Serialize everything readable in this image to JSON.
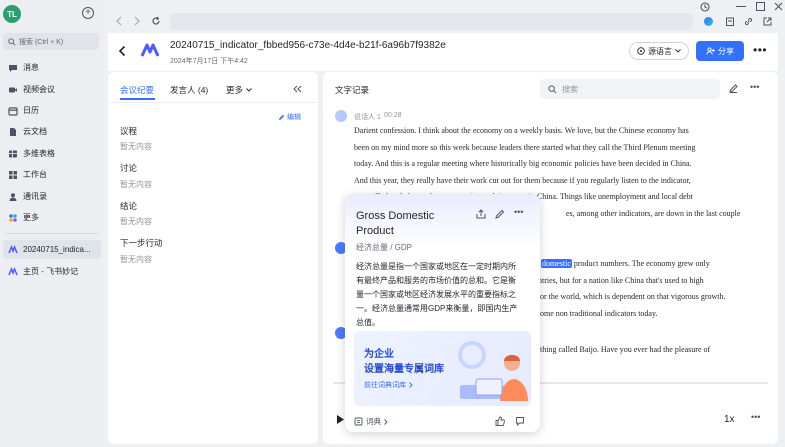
{
  "window": {
    "avatar_initials": "TL",
    "accent_color": "#3370ff"
  },
  "sidebar": {
    "search_placeholder": "搜索 (Ctrl + K)",
    "items": [
      {
        "label": "消息",
        "icon": "message-icon"
      },
      {
        "label": "视频会议",
        "icon": "video-icon"
      },
      {
        "label": "日历",
        "icon": "calendar-icon"
      },
      {
        "label": "云文档",
        "icon": "docs-icon"
      },
      {
        "label": "多维表格",
        "icon": "table-icon"
      },
      {
        "label": "工作台",
        "icon": "workbench-icon"
      },
      {
        "label": "通讯录",
        "icon": "contacts-icon"
      },
      {
        "label": "更多",
        "icon": "more-apps-icon"
      }
    ],
    "pinned": [
      {
        "label": "20240715_indica..."
      },
      {
        "label": "主页 - 飞书妙记"
      }
    ]
  },
  "header": {
    "title": "20240715_indicator_fbbed956-c73e-4d4e-b21f-6a96b7f9382e",
    "date": "2024年7月17日 下午4:42",
    "language_button": "源语言",
    "share_button": "分享"
  },
  "left_panel": {
    "tabs": [
      {
        "label": "会议纪要"
      },
      {
        "label": "发言人 (4)"
      },
      {
        "label": "更多"
      }
    ],
    "edit_label": "编辑",
    "sections": [
      {
        "title": "议程",
        "content": "暂无内容"
      },
      {
        "title": "讨论",
        "content": "暂无内容"
      },
      {
        "title": "结论",
        "content": "暂无内容"
      },
      {
        "title": "下一步行动",
        "content": "暂无内容"
      }
    ]
  },
  "transcript": {
    "title": "文字记录",
    "search_placeholder": "搜索",
    "speaker1": {
      "name": "说话人 1",
      "time": "00:28"
    },
    "para1": [
      "Darient confession. I think about the economy on a weekly basis. We love, but the Chinese economy has",
      "been on my mind more so this week because leaders there started what they call the Third Plenum meeting",
      "today. And this is a regular meeting where historically big economic policies have been decided in China.",
      "And this year, they really have their work cut out for them because if you regularly listen to the indicator,",
      "you will already know the economy is not doing great in China. Things like unemployment and local debt",
      "es, among other indicators, are down in the last couple"
    ],
    "para2": [
      "domestic",
      " product numbers. The economy grew only",
      "ntries, but for a nation like China that's used to high",
      "or the world, which is dependent on that vigorous growth.",
      "ome non traditional indicators today."
    ],
    "para3": "thing called Baijo. Have you ever had the pleasure of",
    "speed": "1x"
  },
  "popup": {
    "title": "Gross Domestic Product",
    "title_line1": "Gross Domestic",
    "title_line2": "Product",
    "subtitle": "经济总量 / GDP",
    "definition_lines": [
      "经济总量是指一个国家或地区在一定时期内所",
      "有最终产品和服务的市场价值的总和。它是衡",
      "量一个国家或地区经济发展水平的重要指标之",
      "一。经济总量通常用GDP来衡量，即国内生产",
      "总值。"
    ],
    "banner_line1": "为企业",
    "banner_line2": "设置海量专属词库",
    "banner_link": "前往词典词库",
    "footer_label": "词典"
  }
}
